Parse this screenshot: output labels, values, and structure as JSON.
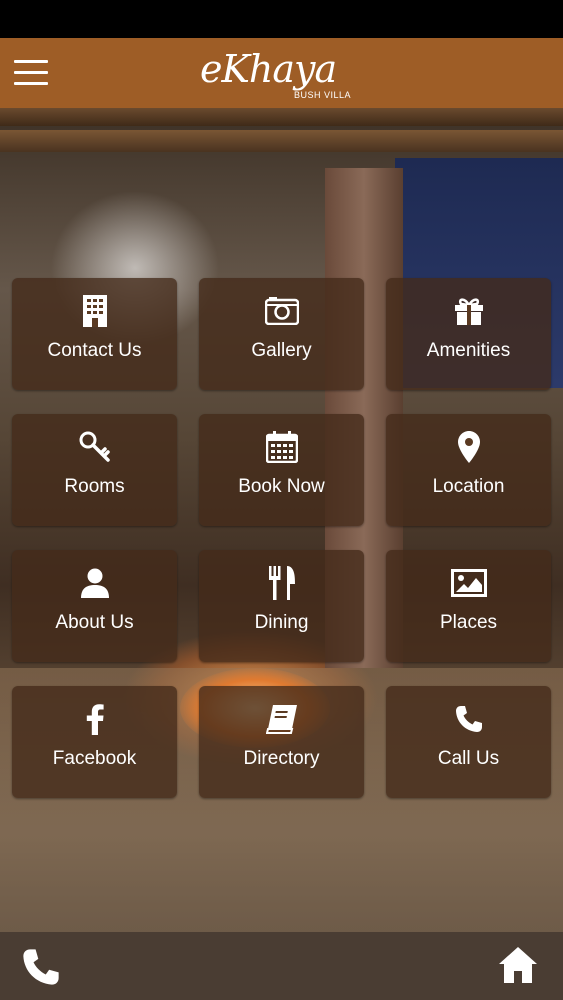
{
  "app": {
    "logo_main": "eKhaya",
    "logo_sub": "BUSH VILLA"
  },
  "colors": {
    "header_bg": "#9e5d26",
    "tile_bg": "#442a1a",
    "bottom_bar_bg": "#4a3d33",
    "text": "#ffffff"
  },
  "menu": {
    "tiles": [
      {
        "label": "Contact Us",
        "icon": "building-icon"
      },
      {
        "label": "Gallery",
        "icon": "camera-icon"
      },
      {
        "label": "Amenities",
        "icon": "gift-icon"
      },
      {
        "label": "Rooms",
        "icon": "key-icon"
      },
      {
        "label": "Book Now",
        "icon": "calendar-icon"
      },
      {
        "label": "Location",
        "icon": "map-pin-icon"
      },
      {
        "label": "About Us",
        "icon": "user-icon"
      },
      {
        "label": "Dining",
        "icon": "cutlery-icon"
      },
      {
        "label": "Places",
        "icon": "image-icon"
      },
      {
        "label": "Facebook",
        "icon": "facebook-icon"
      },
      {
        "label": "Directory",
        "icon": "book-icon"
      },
      {
        "label": "Call Us",
        "icon": "phone-icon"
      }
    ]
  },
  "bottom_bar": {
    "left_icon": "phone-icon",
    "right_icon": "home-icon"
  }
}
